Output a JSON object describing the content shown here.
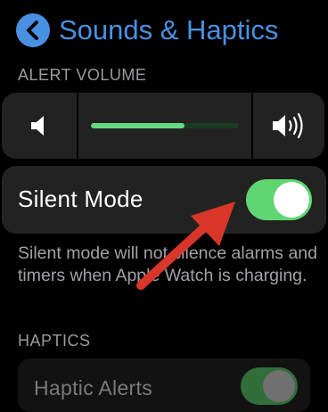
{
  "header": {
    "title": "Sounds & Haptics",
    "back_icon": "chevron-left-icon",
    "accent": "#4a90e2"
  },
  "alert_volume": {
    "section_label": "ALERT VOLUME",
    "level": 0.63,
    "decrease_icon": "speaker-low-icon",
    "increase_icon": "speaker-high-icon",
    "fill_color": "#65d982"
  },
  "silent_mode": {
    "label": "Silent Mode",
    "on": true,
    "toggle_color": "#5fd672"
  },
  "description": "Silent mode will not silence alarms and timers when Apple Watch is charging.",
  "haptics": {
    "section_label": "HAPTICS",
    "haptic_alerts": {
      "label": "Haptic Alerts",
      "on": true
    }
  },
  "annotation": {
    "arrow_color": "#d9362a"
  }
}
